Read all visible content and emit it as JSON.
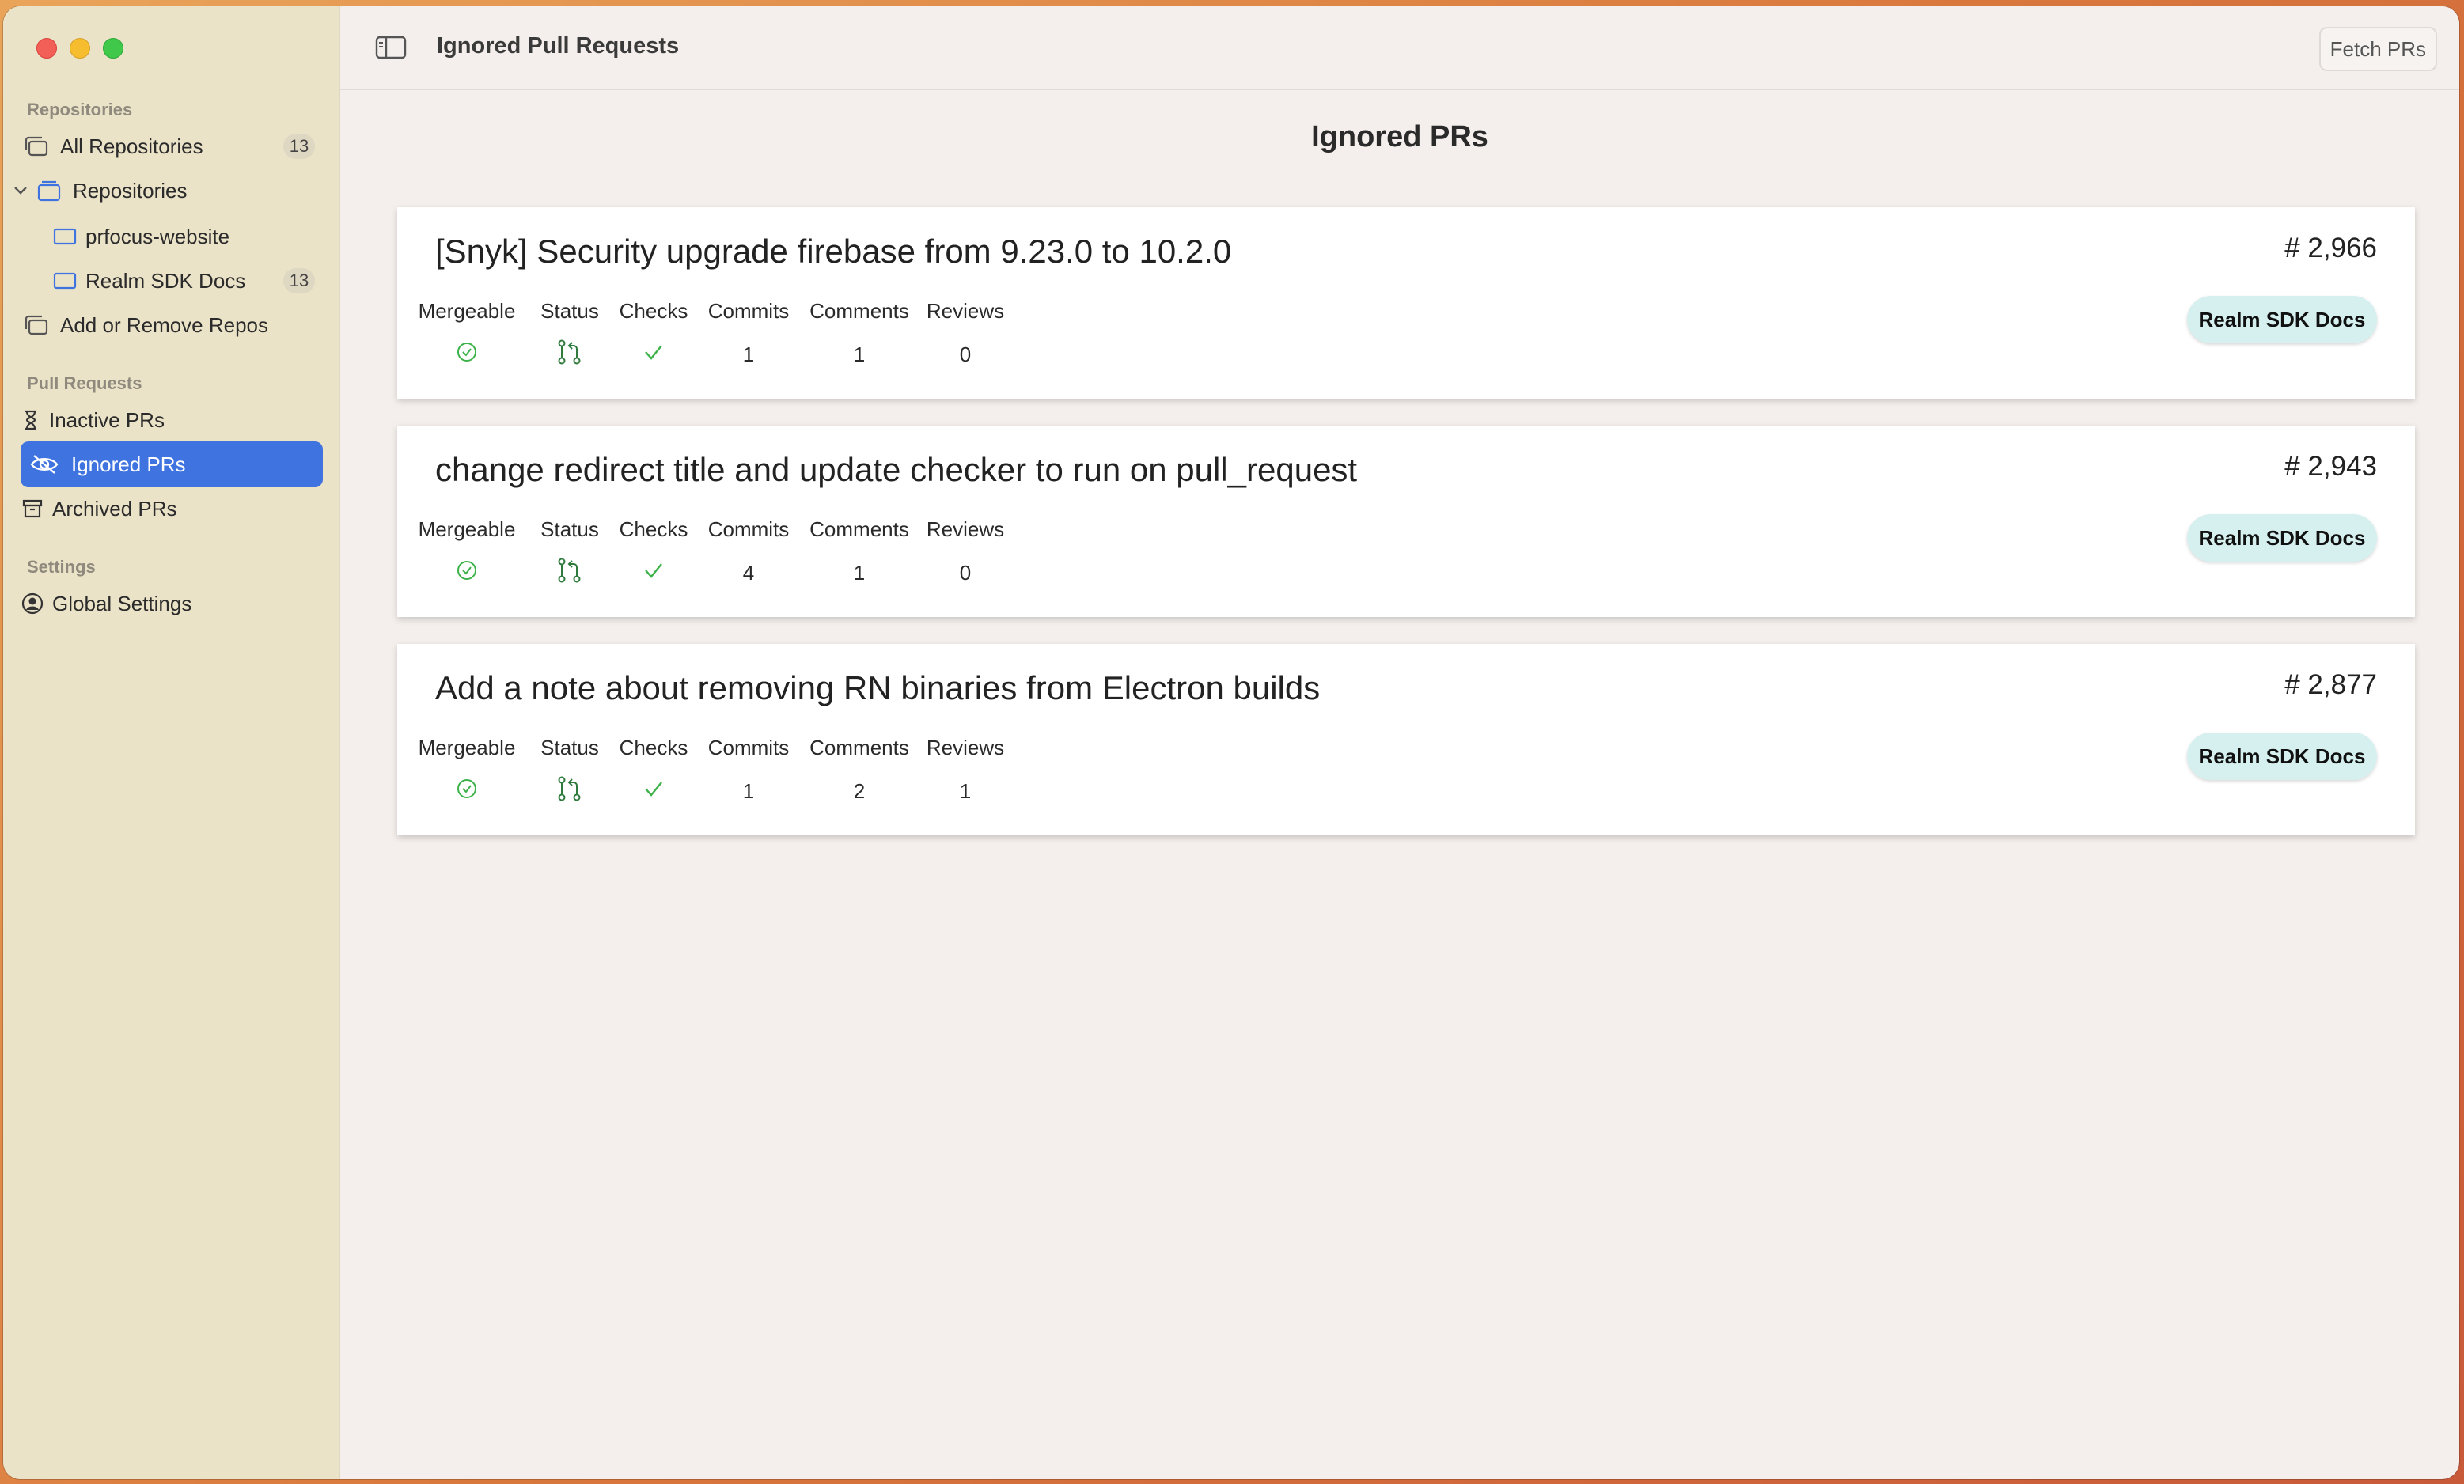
{
  "sidebar": {
    "repositories_label": "Repositories",
    "items_repos": [
      {
        "label": "All Repositories",
        "badge": "13",
        "icon": "stacked-folders-icon"
      },
      {
        "label": "Repositories",
        "icon": "repository-group-icon"
      },
      {
        "label": "prfocus-website",
        "icon": "repo-icon"
      },
      {
        "label": "Realm SDK Docs",
        "badge": "13",
        "icon": "repo-icon"
      },
      {
        "label": "Add or Remove Repos",
        "icon": "stacked-folders-icon"
      }
    ],
    "pull_requests_label": "Pull Requests",
    "items_prs": [
      {
        "label": "Inactive PRs",
        "icon": "hourglass-icon"
      },
      {
        "label": "Ignored PRs",
        "icon": "eye-slash-icon",
        "selected": true
      },
      {
        "label": "Archived PRs",
        "icon": "archive-box-icon"
      }
    ],
    "settings_label": "Settings",
    "items_settings": [
      {
        "label": "Global Settings",
        "icon": "person-circle-icon"
      }
    ]
  },
  "toolbar": {
    "title": "Ignored Pull Requests",
    "fetch_label": "Fetch PRs"
  },
  "main": {
    "page_title": "Ignored PRs",
    "column_headers": [
      "Mergeable",
      "Status",
      "Checks",
      "Commits",
      "Comments",
      "Reviews"
    ],
    "prs": [
      {
        "title": "[Snyk] Security upgrade firebase from 9.23.0 to 10.2.0",
        "number": "# 2,966",
        "repo": "Realm SDK Docs",
        "commits": "1",
        "comments": "1",
        "reviews": "0"
      },
      {
        "title": "change redirect title and update checker to run on pull_request",
        "number": "# 2,943",
        "repo": "Realm SDK Docs",
        "commits": "4",
        "comments": "1",
        "reviews": "0"
      },
      {
        "title": "Add a note about removing RN binaries from Electron builds",
        "number": "# 2,877",
        "repo": "Realm SDK Docs",
        "commits": "1",
        "comments": "2",
        "reviews": "1"
      }
    ]
  },
  "colors": {
    "accent": "#3f73e0",
    "sidebar_bg": "#ebe3c8",
    "success_green": "#3db24a",
    "repo_pill": "#d5f0ef"
  }
}
